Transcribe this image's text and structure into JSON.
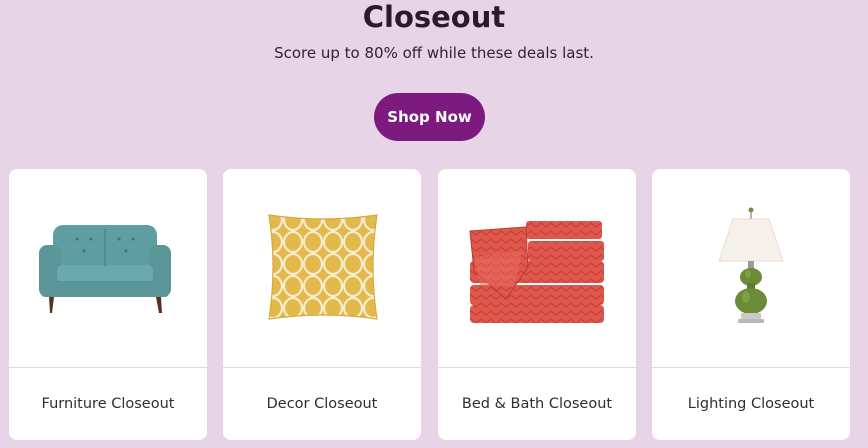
{
  "hero": {
    "title": "Closeout",
    "subtitle": "Score up to 80% off while these deals last.",
    "cta_label": "Shop Now"
  },
  "colors": {
    "background": "#e7d4e6",
    "cta": "#7d1a7f",
    "card": "#ffffff"
  },
  "categories": [
    {
      "label": "Furniture Closeout",
      "icon": "loveseat-icon"
    },
    {
      "label": "Decor Closeout",
      "icon": "pillow-icon"
    },
    {
      "label": "Bed & Bath Closeout",
      "icon": "towels-icon"
    },
    {
      "label": "Lighting Closeout",
      "icon": "lamp-icon"
    }
  ]
}
